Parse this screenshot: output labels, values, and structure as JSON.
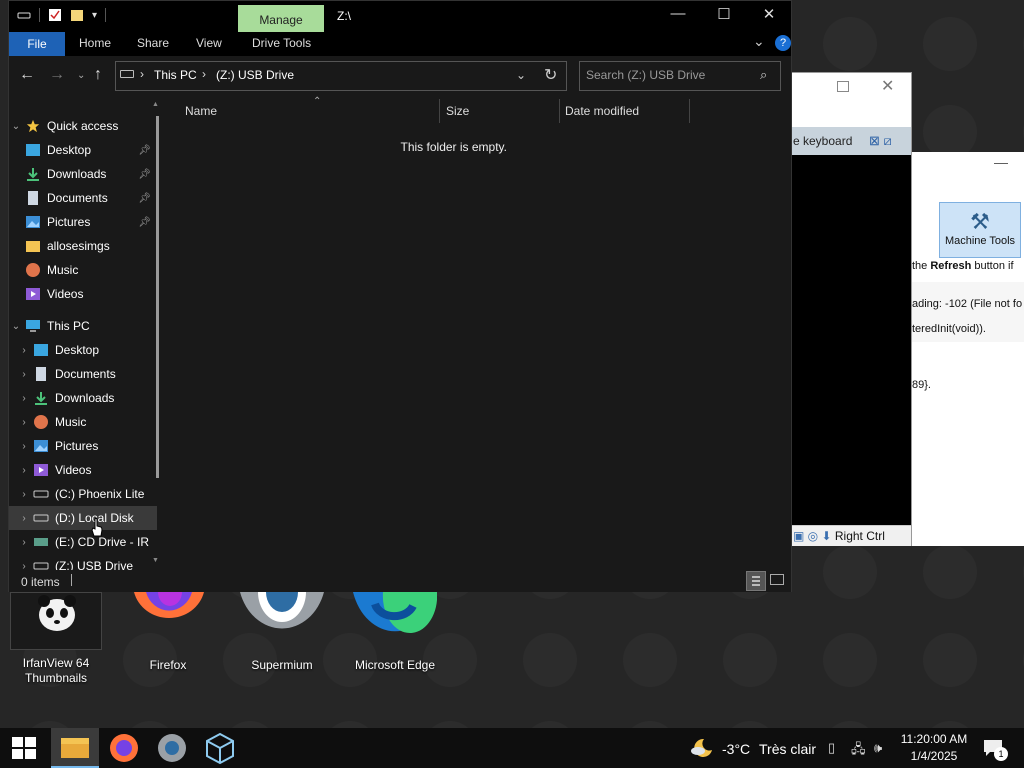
{
  "vm_window": {
    "keyboard_notice": "e keyboard",
    "status_host_key": "Right Ctrl"
  },
  "vm_manager": {
    "machine_tools": "Machine Tools",
    "text_line1_pre": "the ",
    "text_line1_bold": "Refresh",
    "text_line1_post": " button if",
    "text_line2": "ading: -102 (File not fo",
    "text_line3": "teredInit(void)).",
    "text_line4": "89}."
  },
  "desktop": {
    "icons": [
      {
        "label": "IrfanView 64 Thumbnails"
      },
      {
        "label": "Firefox"
      },
      {
        "label": "Supermium"
      },
      {
        "label": "Microsoft Edge"
      }
    ]
  },
  "explorer": {
    "title": "Z:\\",
    "contextual_tab": "Manage",
    "ribbon_tabs": [
      "File",
      "Home",
      "Share",
      "View",
      "Drive Tools"
    ],
    "breadcrumb": [
      "This PC",
      "(Z:) USB Drive"
    ],
    "search_placeholder": "Search (Z:) USB Drive",
    "columns": [
      "Name",
      "Size",
      "Date modified"
    ],
    "empty_message": "This folder is empty.",
    "status_items": "0 items",
    "nav": {
      "quick_access": "Quick access",
      "quick_items": [
        "Desktop",
        "Downloads",
        "Documents",
        "Pictures",
        "allosesimgs",
        "Music",
        "Videos"
      ],
      "this_pc": "This PC",
      "pc_items": [
        "Desktop",
        "Documents",
        "Downloads",
        "Music",
        "Pictures",
        "Videos",
        "(C:) Phoenix Lite",
        "(D:) Local Disk",
        "(E:) CD Drive - IR",
        "(Z:) USB Drive"
      ]
    }
  },
  "taskbar": {
    "weather_temp": "-3°C",
    "weather_desc": "Très clair",
    "time": "11:20:00 AM",
    "date": "1/4/2025",
    "notification_count": "1"
  },
  "colors": {
    "accent": "#1e62b6",
    "manage_tab": "#a8dc9a",
    "explorer_bg": "#191919"
  }
}
